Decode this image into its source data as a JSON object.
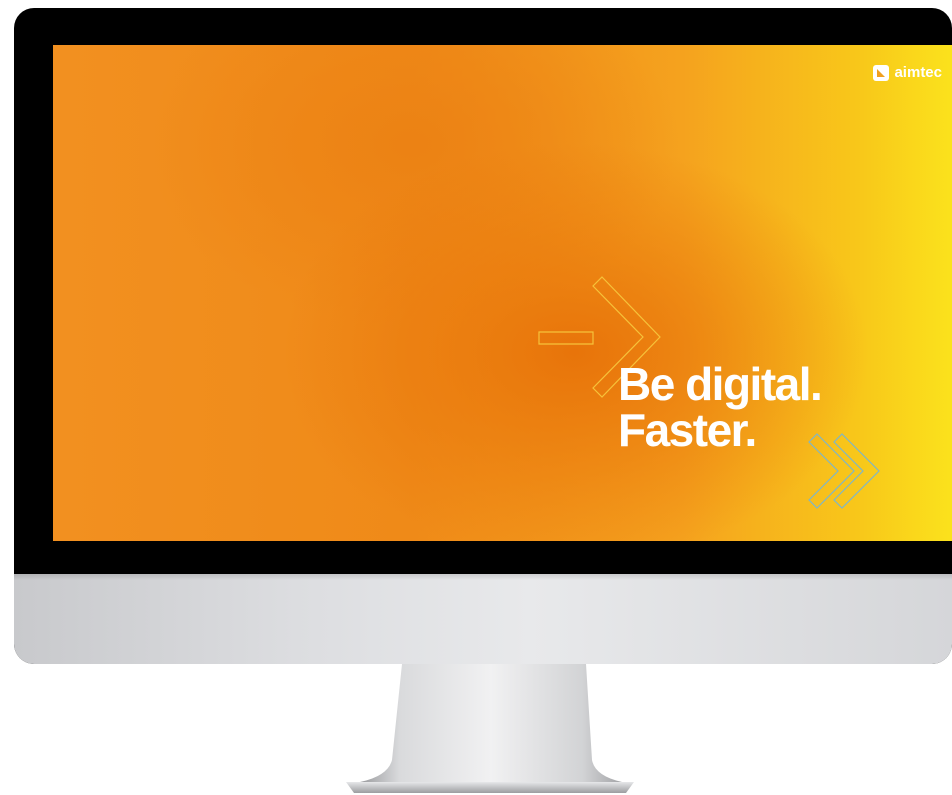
{
  "screen": {
    "brand": "aimtec",
    "headline_line1": "Be digital.",
    "headline_line2": "Faster."
  },
  "icons": {
    "logo": "aimtec-logo-icon",
    "arrow": "outline-arrow-icon",
    "chevrons": "double-chevron-icon"
  },
  "colors": {
    "background_orange": "#ef8a18",
    "background_yellow": "#fbe21c",
    "text": "#ffffff",
    "bezel": "#000000",
    "chin": "#dcdde0"
  }
}
